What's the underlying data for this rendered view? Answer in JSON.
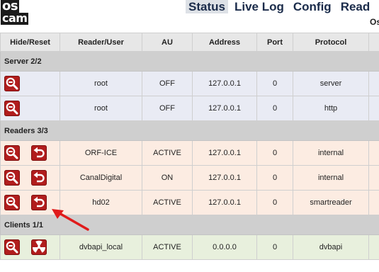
{
  "logo": {
    "line1": "os",
    "line2": "cam"
  },
  "nav": {
    "status": "Status",
    "live_log": "Live Log",
    "config": "Config",
    "readers": "Read"
  },
  "subtitle": "Os",
  "columns": [
    "Hide/Reset",
    "Reader/User",
    "AU",
    "Address",
    "Port",
    "Protocol",
    ""
  ],
  "sections": {
    "servers": {
      "title": "Server 2/2",
      "rows": [
        {
          "name": "root",
          "au": "OFF",
          "address": "127.0.0.1",
          "port": "0",
          "protocol": "server"
        },
        {
          "name": "root",
          "au": "OFF",
          "address": "127.0.0.1",
          "port": "0",
          "protocol": "http"
        }
      ]
    },
    "readers": {
      "title": "Readers 3/3",
      "rows": [
        {
          "name": "ORF-ICE",
          "au": "ACTIVE",
          "address": "127.0.0.1",
          "port": "0",
          "protocol": "internal"
        },
        {
          "name": "CanalDigital",
          "au": "ON",
          "address": "127.0.0.1",
          "port": "0",
          "protocol": "internal"
        },
        {
          "name": "hd02",
          "au": "ACTIVE",
          "address": "127.0.0.1",
          "port": "0",
          "protocol": "smartreader"
        }
      ]
    },
    "clients": {
      "title": "Clients 1/1",
      "rows": [
        {
          "name": "dvbapi_local",
          "au": "ACTIVE",
          "address": "0.0.0.0",
          "port": "0",
          "protocol": "dvbapi"
        }
      ]
    }
  },
  "icons": {
    "hide": "magnifier-minus-icon",
    "reset": "reset-arrow-icon",
    "kill": "radiation-icon",
    "annotation": "red-pointer-arrow-icon"
  },
  "colors": {
    "button": "#b11d1d",
    "server_row": "#e9ebf4",
    "reader_row": "#fcece2",
    "client_row": "#e8f0dd",
    "section_header": "#cfcfcf",
    "annotation_arrow": "#e01b1b"
  }
}
